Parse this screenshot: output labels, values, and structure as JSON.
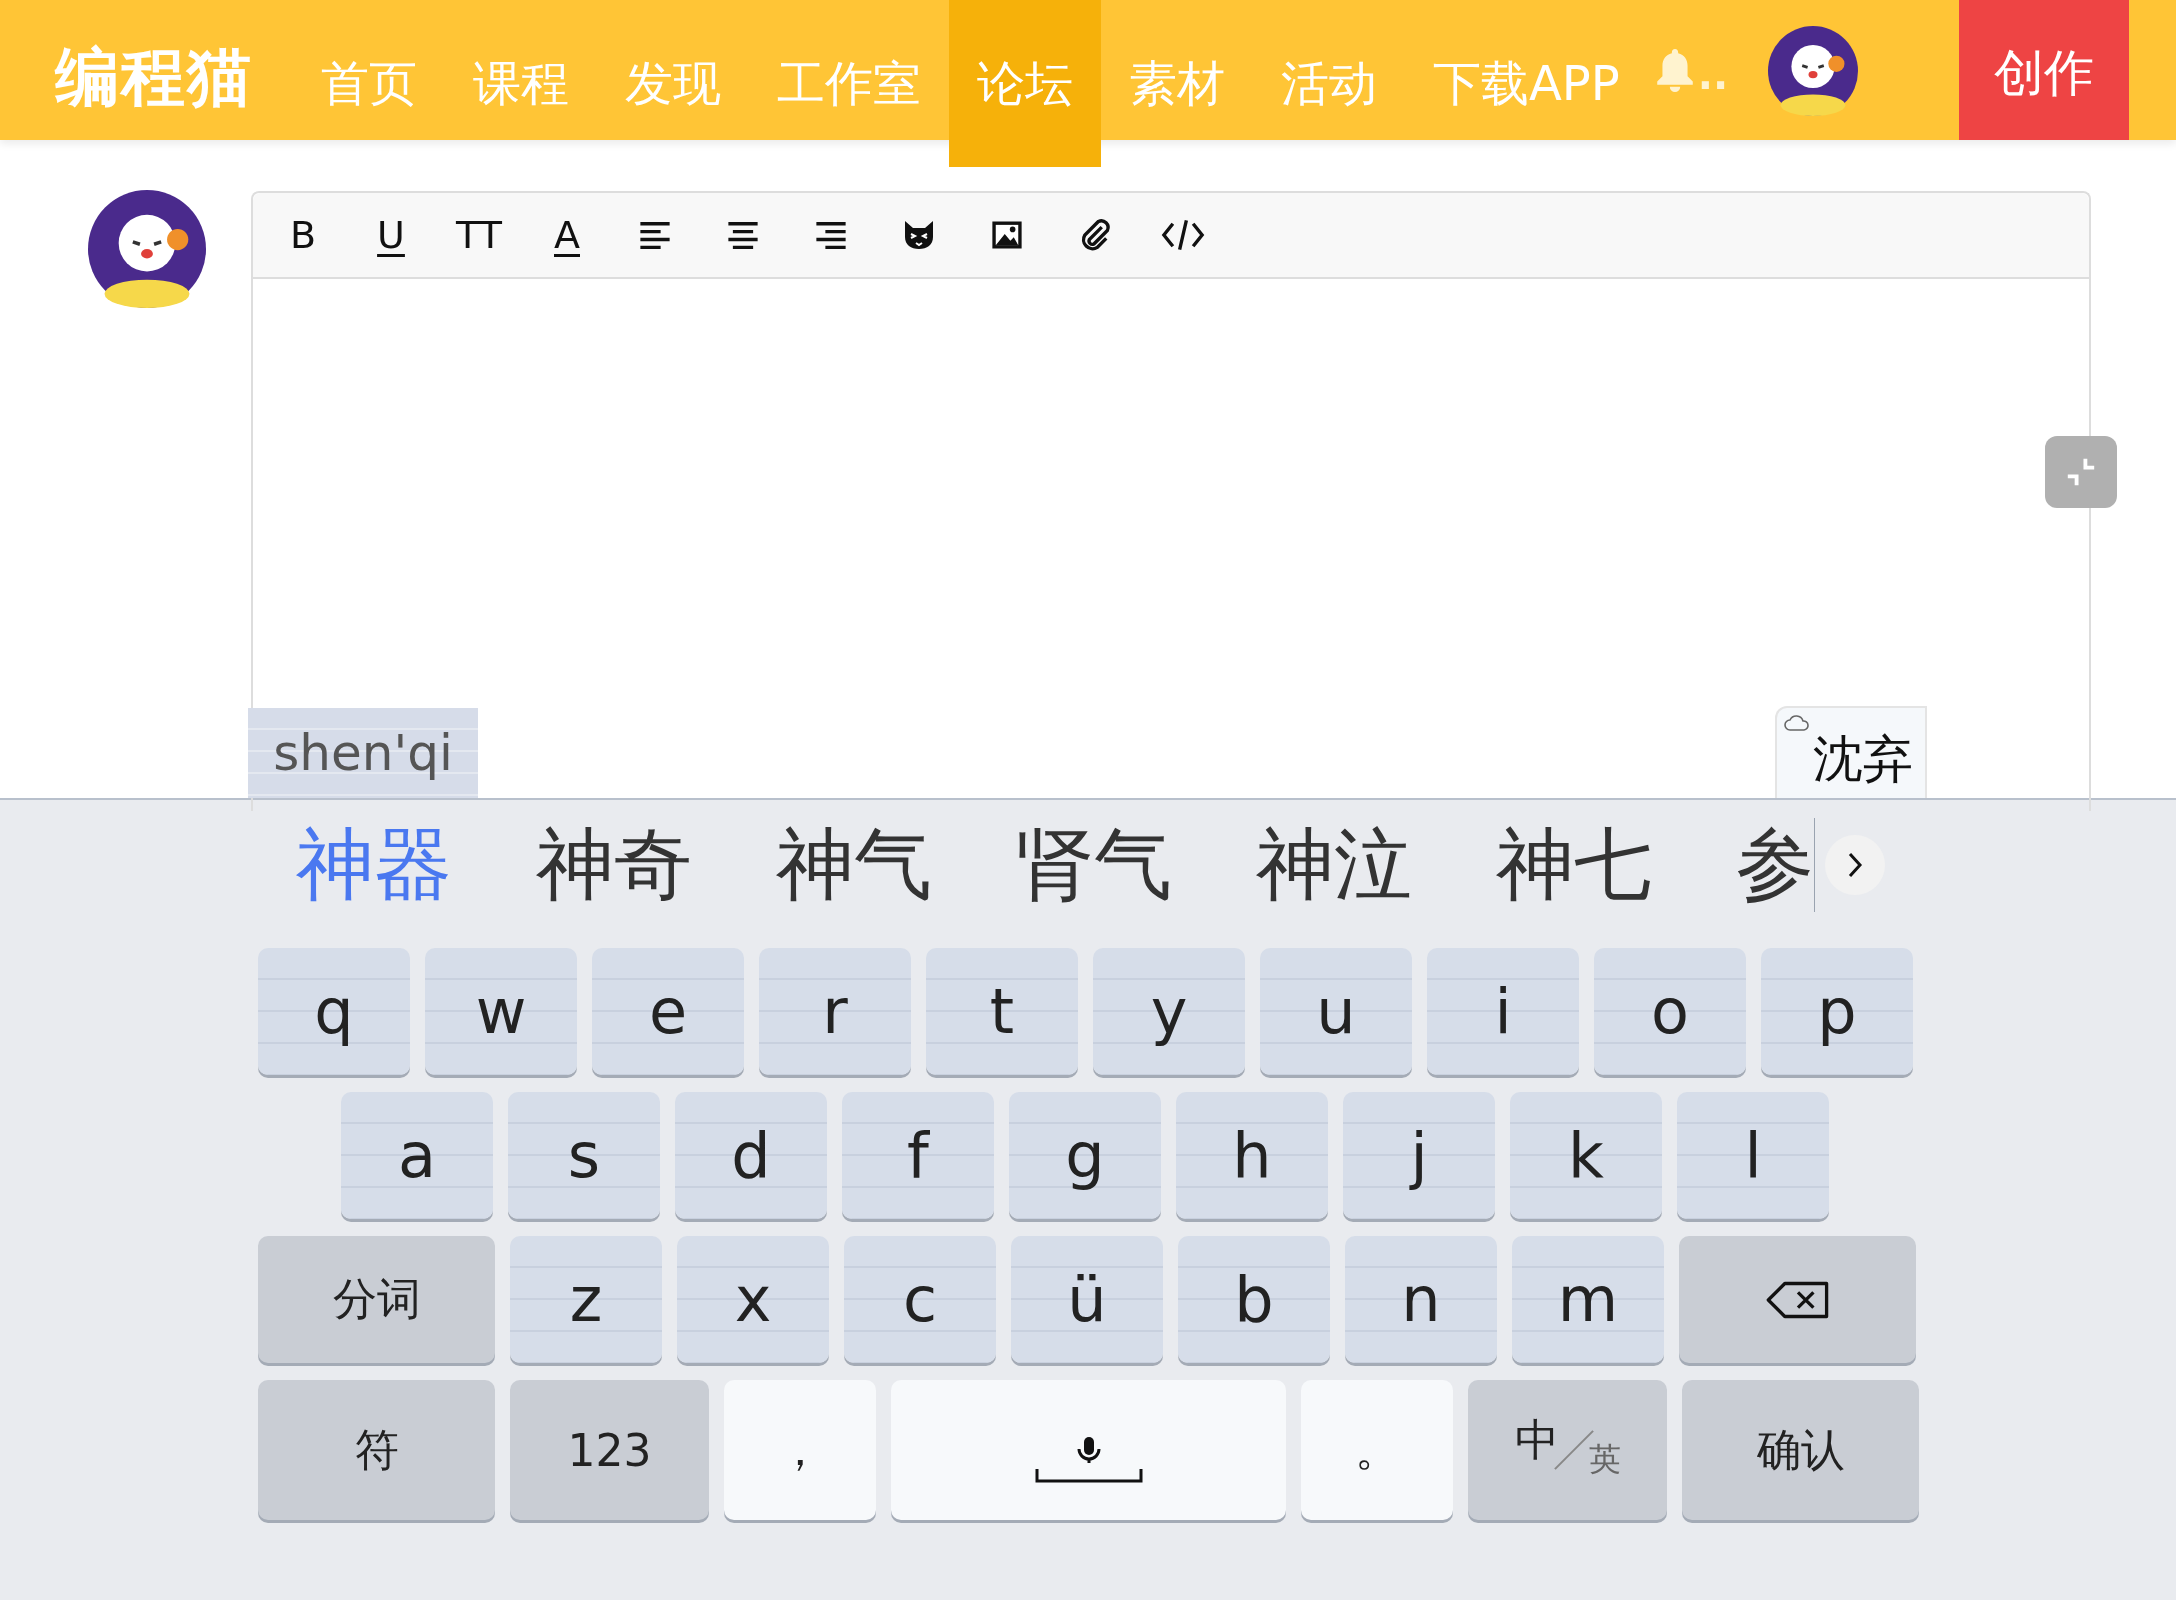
{
  "nav": {
    "logo": "编程猫",
    "items": [
      {
        "label": "首页",
        "selected": false
      },
      {
        "label": "课程",
        "selected": false
      },
      {
        "label": "发现",
        "selected": false
      },
      {
        "label": "工作室",
        "selected": false
      },
      {
        "label": "论坛",
        "selected": true
      },
      {
        "label": "素材",
        "selected": false
      },
      {
        "label": "活动",
        "selected": false
      },
      {
        "label": "下载APP",
        "selected": false
      }
    ],
    "notice_more": "..",
    "create_button": "创作"
  },
  "editor": {
    "toolbar": [
      {
        "kind": "text",
        "label": "B"
      },
      {
        "kind": "underline",
        "label": "U"
      },
      {
        "kind": "text",
        "label": "TT"
      },
      {
        "kind": "underline",
        "label": "A"
      },
      {
        "kind": "align-left"
      },
      {
        "kind": "align-center"
      },
      {
        "kind": "align-right"
      },
      {
        "kind": "emoji"
      },
      {
        "kind": "image"
      },
      {
        "kind": "attach"
      },
      {
        "kind": "code"
      }
    ]
  },
  "ime": {
    "composition": "shen'qi",
    "cloud_suggestion": "沈弃",
    "candidates": [
      {
        "text": "神器",
        "selected": true
      },
      {
        "text": "神奇",
        "selected": false
      },
      {
        "text": "神气",
        "selected": false
      },
      {
        "text": "肾气",
        "selected": false
      },
      {
        "text": "神泣",
        "selected": false
      },
      {
        "text": "神七",
        "selected": false
      },
      {
        "text": "参",
        "selected": false
      }
    ],
    "rows": [
      {
        "keys": [
          {
            "kind": "letter",
            "label": "q"
          },
          {
            "kind": "letter",
            "label": "w"
          },
          {
            "kind": "letter",
            "label": "e"
          },
          {
            "kind": "letter",
            "label": "r"
          },
          {
            "kind": "letter",
            "label": "t"
          },
          {
            "kind": "letter",
            "label": "y"
          },
          {
            "kind": "letter",
            "label": "u"
          },
          {
            "kind": "letter",
            "label": "i"
          },
          {
            "kind": "letter",
            "label": "o"
          },
          {
            "kind": "letter",
            "label": "p"
          }
        ]
      },
      {
        "keys": [
          {
            "kind": "letter",
            "label": "a"
          },
          {
            "kind": "letter",
            "label": "s"
          },
          {
            "kind": "letter",
            "label": "d"
          },
          {
            "kind": "letter",
            "label": "f"
          },
          {
            "kind": "letter",
            "label": "g"
          },
          {
            "kind": "letter",
            "label": "h"
          },
          {
            "kind": "letter",
            "label": "j"
          },
          {
            "kind": "letter",
            "label": "k"
          },
          {
            "kind": "letter",
            "label": "l"
          }
        ]
      },
      {
        "keys": [
          {
            "kind": "function",
            "label": "分词"
          },
          {
            "kind": "letter",
            "label": "z"
          },
          {
            "kind": "letter",
            "label": "x"
          },
          {
            "kind": "letter",
            "label": "c"
          },
          {
            "kind": "letter",
            "label": "ü"
          },
          {
            "kind": "letter",
            "label": "b"
          },
          {
            "kind": "letter",
            "label": "n"
          },
          {
            "kind": "letter",
            "label": "m"
          },
          {
            "kind": "delete"
          }
        ]
      },
      {
        "keys": [
          {
            "kind": "function",
            "label": "符"
          },
          {
            "kind": "function",
            "label": "123"
          },
          {
            "kind": "light",
            "label": "，"
          },
          {
            "kind": "space"
          },
          {
            "kind": "light",
            "label": "。"
          },
          {
            "kind": "lang",
            "label": "中",
            "sub": "英"
          },
          {
            "kind": "function",
            "label": "确认"
          }
        ]
      }
    ]
  }
}
